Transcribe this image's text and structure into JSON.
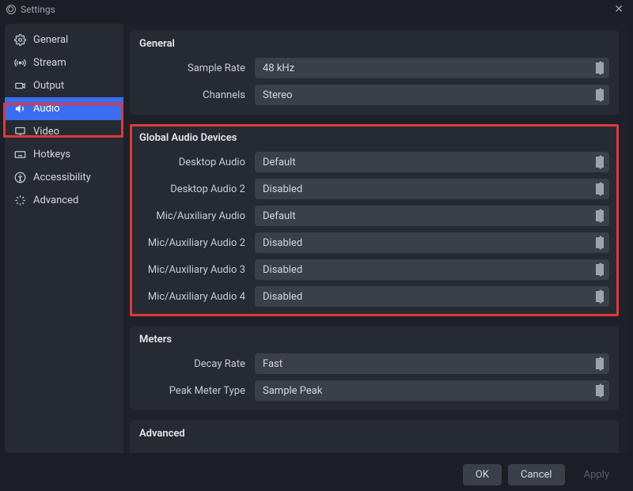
{
  "window": {
    "title": "Settings"
  },
  "sidebar": {
    "items": [
      {
        "label": "General"
      },
      {
        "label": "Stream"
      },
      {
        "label": "Output"
      },
      {
        "label": "Audio"
      },
      {
        "label": "Video"
      },
      {
        "label": "Hotkeys"
      },
      {
        "label": "Accessibility"
      },
      {
        "label": "Advanced"
      }
    ],
    "active_index": 3
  },
  "sections": {
    "general": {
      "title": "General",
      "rows": [
        {
          "label": "Sample Rate",
          "value": "48 kHz"
        },
        {
          "label": "Channels",
          "value": "Stereo"
        }
      ]
    },
    "global_audio": {
      "title": "Global Audio Devices",
      "rows": [
        {
          "label": "Desktop Audio",
          "value": "Default"
        },
        {
          "label": "Desktop Audio 2",
          "value": "Disabled"
        },
        {
          "label": "Mic/Auxiliary Audio",
          "value": "Default"
        },
        {
          "label": "Mic/Auxiliary Audio 2",
          "value": "Disabled"
        },
        {
          "label": "Mic/Auxiliary Audio 3",
          "value": "Disabled"
        },
        {
          "label": "Mic/Auxiliary Audio 4",
          "value": "Disabled"
        }
      ]
    },
    "meters": {
      "title": "Meters",
      "rows": [
        {
          "label": "Decay Rate",
          "value": "Fast"
        },
        {
          "label": "Peak Meter Type",
          "value": "Sample Peak"
        }
      ]
    },
    "advanced": {
      "title": "Advanced"
    }
  },
  "footer": {
    "ok": "OK",
    "cancel": "Cancel",
    "apply": "Apply"
  }
}
